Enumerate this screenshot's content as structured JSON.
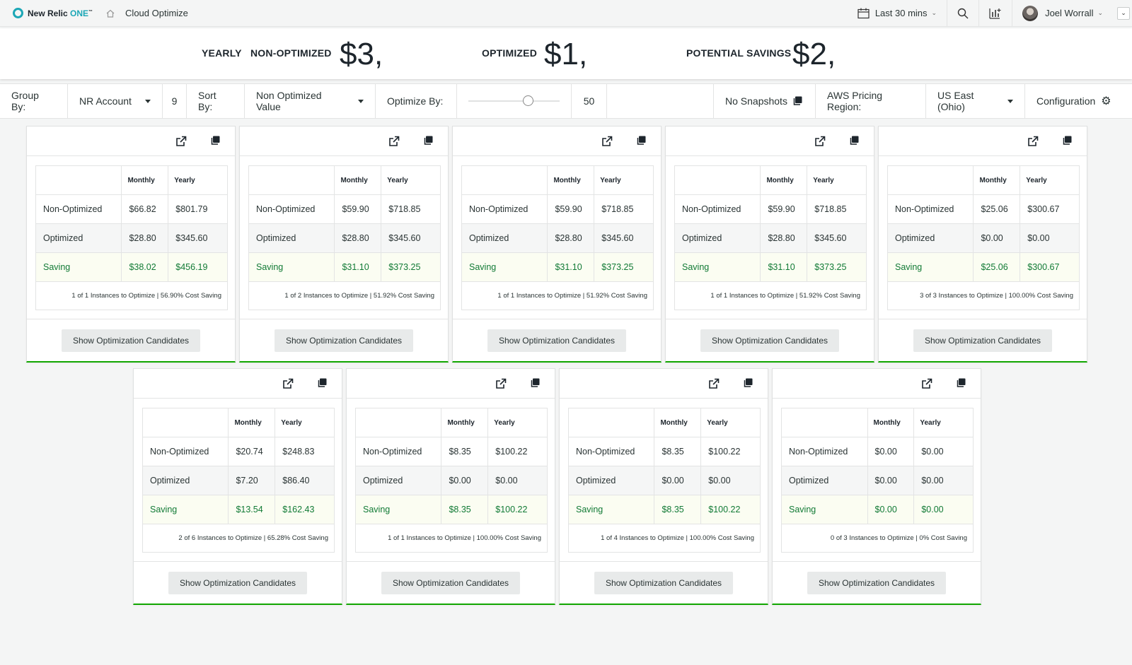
{
  "nav": {
    "brand": "New Relic ",
    "brand_one": "ONE",
    "brand_tm": "™",
    "breadcrumb": "Cloud Optimize",
    "time_range": "Last 30 mins",
    "user": "Joel Worrall"
  },
  "summary": {
    "yearly_label": "YEARLY",
    "non_optimized_label": "NON-OPTIMIZED",
    "non_optimized_value": "$3,",
    "optimized_label": "OPTIMIZED",
    "optimized_value": "$1,",
    "savings_label": "POTENTIAL SAVINGS",
    "savings_value": "$2,"
  },
  "toolbar": {
    "group_by_label": "Group By:",
    "group_by_value": "NR Account",
    "group_count": "9",
    "sort_by_label": "Sort By:",
    "sort_by_value": "Non Optimized Value",
    "optimize_by_label": "Optimize By:",
    "optimize_value": "50",
    "snapshots_label": "No Snapshots",
    "region_label": "AWS Pricing Region:",
    "region_value": "US East (Ohio)",
    "config_label": "Configuration"
  },
  "table_headers": {
    "monthly": "Monthly",
    "yearly": "Yearly"
  },
  "row_labels": {
    "non_optimized": "Non-Optimized",
    "optimized": "Optimized",
    "saving": "Saving"
  },
  "button_label": "Show Optimization Candidates",
  "cards": [
    {
      "non_opt_m": "$66.82",
      "non_opt_y": "$801.79",
      "opt_m": "$28.80",
      "opt_y": "$345.60",
      "save_m": "$38.02",
      "save_y": "$456.19",
      "footer": "1 of 1 Instances to Optimize | 56.90% Cost Saving"
    },
    {
      "non_opt_m": "$59.90",
      "non_opt_y": "$718.85",
      "opt_m": "$28.80",
      "opt_y": "$345.60",
      "save_m": "$31.10",
      "save_y": "$373.25",
      "footer": "1 of 2 Instances to Optimize | 51.92% Cost Saving"
    },
    {
      "non_opt_m": "$59.90",
      "non_opt_y": "$718.85",
      "opt_m": "$28.80",
      "opt_y": "$345.60",
      "save_m": "$31.10",
      "save_y": "$373.25",
      "footer": "1 of 1 Instances to Optimize | 51.92% Cost Saving"
    },
    {
      "non_opt_m": "$59.90",
      "non_opt_y": "$718.85",
      "opt_m": "$28.80",
      "opt_y": "$345.60",
      "save_m": "$31.10",
      "save_y": "$373.25",
      "footer": "1 of 1 Instances to Optimize | 51.92% Cost Saving"
    },
    {
      "non_opt_m": "$25.06",
      "non_opt_y": "$300.67",
      "opt_m": "$0.00",
      "opt_y": "$0.00",
      "save_m": "$25.06",
      "save_y": "$300.67",
      "footer": "3 of 3 Instances to Optimize | 100.00% Cost Saving"
    },
    {
      "non_opt_m": "$20.74",
      "non_opt_y": "$248.83",
      "opt_m": "$7.20",
      "opt_y": "$86.40",
      "save_m": "$13.54",
      "save_y": "$162.43",
      "footer": "2 of 6 Instances to Optimize | 65.28% Cost Saving"
    },
    {
      "non_opt_m": "$8.35",
      "non_opt_y": "$100.22",
      "opt_m": "$0.00",
      "opt_y": "$0.00",
      "save_m": "$8.35",
      "save_y": "$100.22",
      "footer": "1 of 1 Instances to Optimize | 100.00% Cost Saving"
    },
    {
      "non_opt_m": "$8.35",
      "non_opt_y": "$100.22",
      "opt_m": "$0.00",
      "opt_y": "$0.00",
      "save_m": "$8.35",
      "save_y": "$100.22",
      "footer": "1 of 4 Instances to Optimize | 100.00% Cost Saving"
    },
    {
      "non_opt_m": "$0.00",
      "non_opt_y": "$0.00",
      "opt_m": "$0.00",
      "opt_y": "$0.00",
      "save_m": "$0.00",
      "save_y": "$0.00",
      "footer": "0 of 3 Instances to Optimize | 0% Cost Saving"
    }
  ]
}
